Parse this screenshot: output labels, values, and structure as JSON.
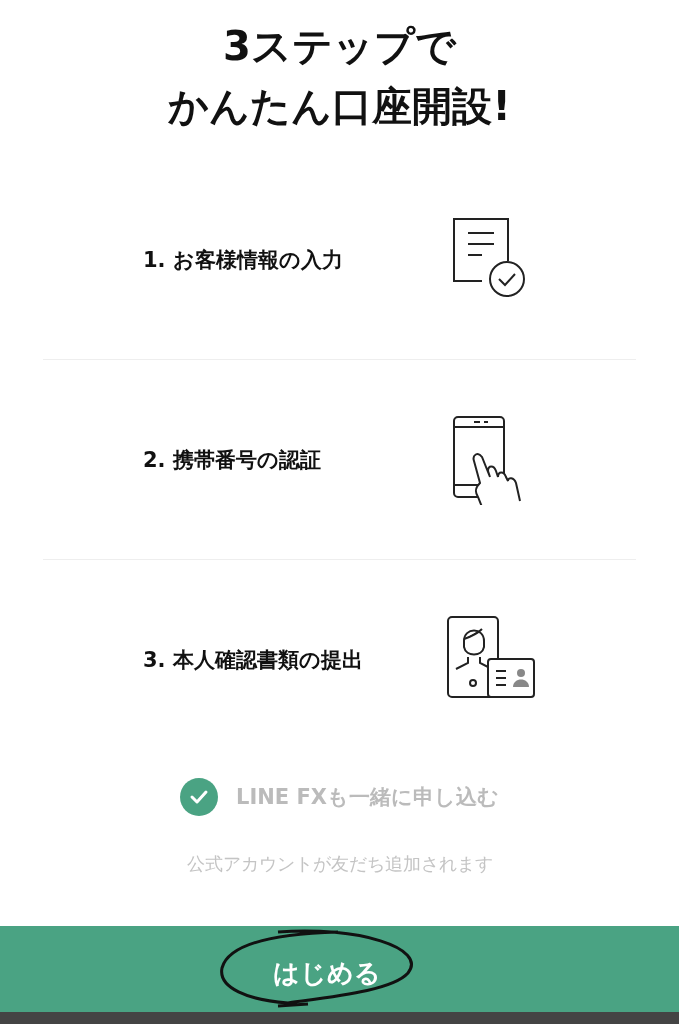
{
  "title": [
    "3ステップで",
    "かんたん口座開設!"
  ],
  "steps": [
    {
      "label": "1. お客様情報の入力",
      "kind": "document"
    },
    {
      "label": "2. 携帯番号の認証",
      "kind": "phone"
    },
    {
      "label": "3. 本人確認書類の提出",
      "kind": "id"
    }
  ],
  "option": {
    "label": "LINE FXも一緒に申し込む",
    "checked": true
  },
  "note": "公式アカウントが友だち追加されます",
  "button": {
    "label": "はじめる"
  }
}
